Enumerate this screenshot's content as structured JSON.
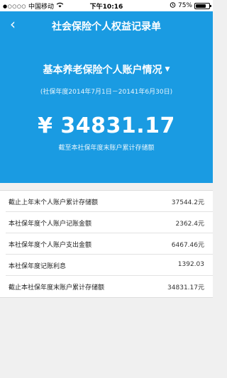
{
  "status_bar": {
    "carrier": "中国移动",
    "time": "下午10:16",
    "battery_text": "75%",
    "battery_level": 0.75
  },
  "nav": {
    "title": "社会保险个人权益记录单",
    "back_label": "‹"
  },
  "account": {
    "selector_label": "基本养老保险个人账户情况",
    "period": "(社保年度2014年7月1日－20141年6月30日)",
    "amount": "¥ 34831.17",
    "amount_caption": "截至本社保年度末账户累计存储额"
  },
  "rows": [
    {
      "label": "截止上年末个人账户累计存储额",
      "value": "37544.2元"
    },
    {
      "label": "本社保年度个人账户记账金额",
      "value": "2362.4元"
    },
    {
      "label": "本社保年度个人账户支出金额",
      "value": "6467.46元"
    },
    {
      "label": "本社保年度记账利息",
      "value": "1392.03"
    },
    {
      "label": "截止本社保年度末账户累计存储额",
      "value": "34831.17元"
    }
  ],
  "colors": {
    "primary": "#1a9be2"
  }
}
